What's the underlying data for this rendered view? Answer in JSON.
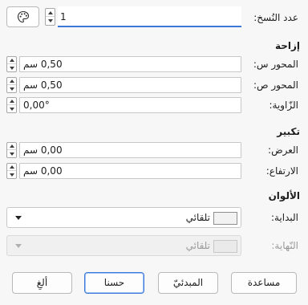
{
  "copies": {
    "label": "عدد النُسخ:",
    "value": "1"
  },
  "offset": {
    "heading": "إزاحة",
    "x_label": "المحور س:",
    "x_value": "0,50 سم",
    "y_label": "المحور ص:",
    "y_value": "0,50 سم",
    "angle_label": "الزّاوية:",
    "angle_value": "0,00°"
  },
  "enlarge": {
    "heading": "تكبير",
    "width_label": "العرض:",
    "width_value": "0,00 سم",
    "height_label": "الارتفاع:",
    "height_value": "0,00 سم"
  },
  "colors": {
    "heading": "الألوان",
    "start_label": "البداية:",
    "start_value": "تلقائي",
    "end_label": "النّهاية:",
    "end_value": "تلقائي"
  },
  "buttons": {
    "help": "مساعدة",
    "reset": "المبدئيّ",
    "ok": "حسنا",
    "cancel": "ألغِ"
  }
}
